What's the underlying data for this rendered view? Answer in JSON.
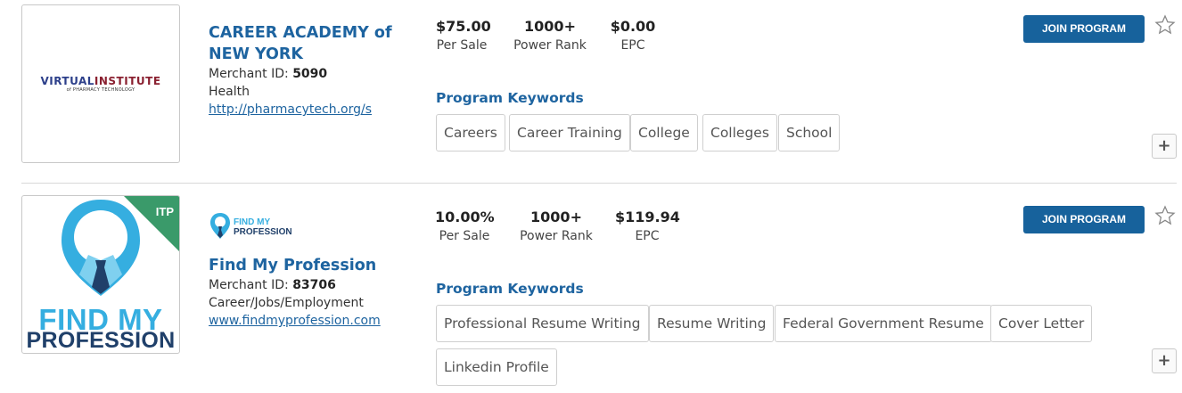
{
  "listings": [
    {
      "logo": {
        "main_dark": "VIRTUAL",
        "main_red": "INSTITUTE",
        "sub": "of PHARMACY TECHNOLOGY"
      },
      "name": "CAREER ACADEMY of NEW YORK",
      "merchant_id_label": "Merchant ID:",
      "merchant_id": "5090",
      "category": "Health",
      "url": "http://pharmacytech.org/s",
      "stats": [
        {
          "value": "$75.00",
          "label": "Per Sale"
        },
        {
          "value": "1000+",
          "label": "Power Rank"
        },
        {
          "value": "$0.00",
          "label": "EPC"
        }
      ],
      "keywords_title": "Program Keywords",
      "keywords": [
        "Careers",
        "Career Training",
        "College",
        "Colleges",
        "School"
      ],
      "join_label": "JOIN PROGRAM",
      "plus_label": "+"
    },
    {
      "logo": {
        "badge": "ITP",
        "line1": "FIND MY",
        "line2": "PROFESSION",
        "small1": "FIND MY",
        "small2": "PROFESSION"
      },
      "name": "Find My Profession",
      "merchant_id_label": "Merchant ID:",
      "merchant_id": "83706",
      "category": "Career/Jobs/Employment",
      "url": "www.findmyprofession.com",
      "stats": [
        {
          "value": "10.00%",
          "label": "Per Sale"
        },
        {
          "value": "1000+",
          "label": "Power Rank"
        },
        {
          "value": "$119.94",
          "label": "EPC"
        }
      ],
      "keywords_title": "Program Keywords",
      "keywords": [
        "Professional Resume Writing",
        "Resume Writing",
        "Federal Government Resume",
        "Cover Letter",
        "Linkedin Profile"
      ],
      "join_label": "JOIN PROGRAM",
      "plus_label": "+"
    }
  ],
  "colors": {
    "link_blue": "#1e64a0",
    "button_blue": "#17629c",
    "itp_green": "#3a9a6a",
    "fmp_light_blue": "#35aee0",
    "fmp_navy": "#20406a"
  }
}
